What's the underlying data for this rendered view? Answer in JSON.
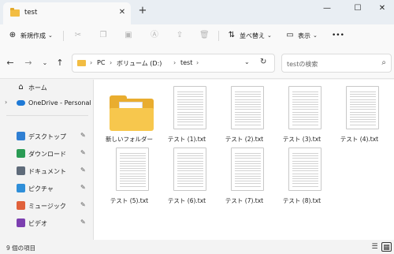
{
  "window": {
    "tab_title": "test",
    "close_tab": "✕",
    "new_tab": "+",
    "minimize": "—",
    "maximize": "☐",
    "close": "✕"
  },
  "toolbar": {
    "new_label": "新規作成",
    "sort_label": "並べ替え",
    "view_label": "表示",
    "more_label": "•••"
  },
  "address": {
    "crumbs": [
      "PC",
      "ボリューム (D:)",
      "test"
    ],
    "search_placeholder": "testの検索"
  },
  "sidebar": {
    "home": "ホーム",
    "onedrive": "OneDrive - Personal",
    "quick": [
      {
        "label": "デスクトップ",
        "icon": "desktop-icon",
        "color": "#2f7fd3"
      },
      {
        "label": "ダウンロード",
        "icon": "download-icon",
        "color": "#2a9b54"
      },
      {
        "label": "ドキュメント",
        "icon": "document-icon",
        "color": "#5f6b7a"
      },
      {
        "label": "ピクチャ",
        "icon": "pictures-icon",
        "color": "#2f8fd9"
      },
      {
        "label": "ミュージック",
        "icon": "music-icon",
        "color": "#e0613b"
      },
      {
        "label": "ビデオ",
        "icon": "video-icon",
        "color": "#7c3fb0"
      }
    ]
  },
  "files": [
    {
      "name": "新しいフォルダー",
      "type": "folder"
    },
    {
      "name": "テスト (1).txt",
      "type": "txt"
    },
    {
      "name": "テスト (2).txt",
      "type": "txt"
    },
    {
      "name": "テスト (3).txt",
      "type": "txt"
    },
    {
      "name": "テスト (4).txt",
      "type": "txt"
    },
    {
      "name": "テスト (5).txt",
      "type": "txt"
    },
    {
      "name": "テスト (6).txt",
      "type": "txt"
    },
    {
      "name": "テスト (7).txt",
      "type": "txt"
    },
    {
      "name": "テスト (8).txt",
      "type": "txt"
    }
  ],
  "status": {
    "item_count": "9 個の項目"
  }
}
